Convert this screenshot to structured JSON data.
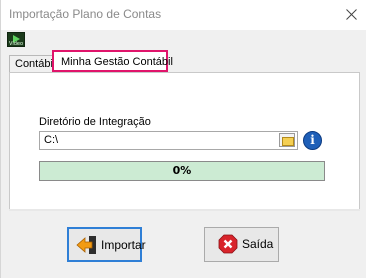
{
  "window": {
    "title": "Importação Plano de Contas"
  },
  "toolbar": {
    "video_label": "Vídeo"
  },
  "tabs": [
    {
      "label": "Contábil"
    },
    {
      "label": "Minha Gestão Contábil"
    }
  ],
  "form": {
    "directory_label": "Diretório de Integração",
    "directory_value": "C:\\"
  },
  "progress": {
    "text": "0%",
    "value": 0
  },
  "buttons": {
    "import_label": "Importar",
    "exit_label": "Saída"
  },
  "colors": {
    "highlight_tab_border": "#e0146b",
    "progress_bg": "#ccebd3",
    "focused_button_border": "#2f7fd6"
  }
}
